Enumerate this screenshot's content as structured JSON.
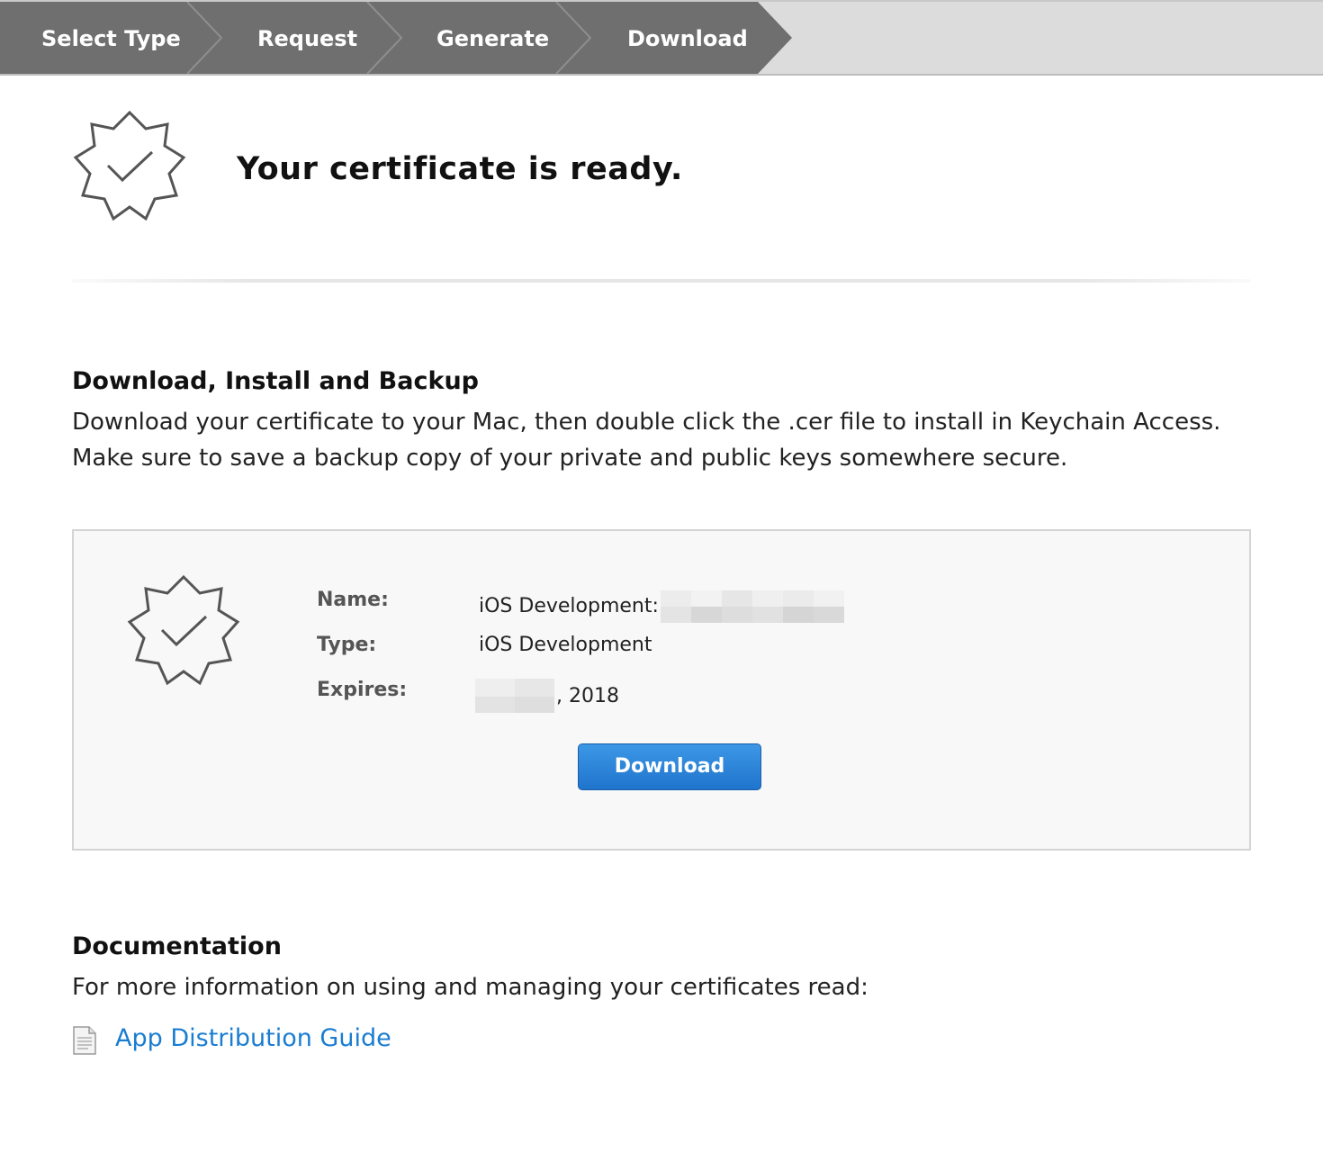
{
  "steps": [
    {
      "label": "Select Type"
    },
    {
      "label": "Request"
    },
    {
      "label": "Generate"
    },
    {
      "label": "Download"
    }
  ],
  "hero": {
    "title": "Your certificate is ready.",
    "icon": "certificate-badge-icon"
  },
  "install": {
    "title": "Download, Install and Backup",
    "body": "Download your certificate to your Mac, then double click the .cer file to install in Keychain Access. Make sure to save a backup copy of your private and public keys somewhere secure."
  },
  "certificate": {
    "name_label": "Name:",
    "name_value": "iOS Development:",
    "type_label": "Type:",
    "type_value": "iOS Development",
    "expires_label": "Expires:",
    "expires_value": ", 2018",
    "download_label": "Download"
  },
  "documentation": {
    "title": "Documentation",
    "body": "For more information on using and managing your certificates read:",
    "link_label": "App Distribution Guide",
    "icon": "document-icon"
  },
  "colors": {
    "step_bg": "#6f6f6f",
    "button_blue": "#2a84d8",
    "link_blue": "#1a7dd1"
  }
}
